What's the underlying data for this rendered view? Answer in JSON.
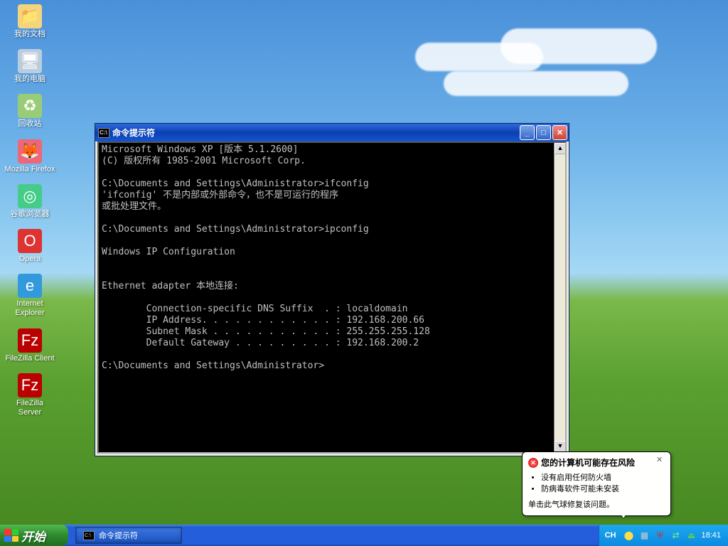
{
  "desktop": {
    "icons": [
      {
        "label": "我的文档",
        "glyph": "📁",
        "bg": "#f4d47c"
      },
      {
        "label": "我的电脑",
        "glyph": "🖥",
        "bg": "#bcd"
      },
      {
        "label": "回收站",
        "glyph": "♻",
        "bg": "#9c7"
      },
      {
        "label": "Mozilla Firefox",
        "glyph": "🦊",
        "bg": "#e67"
      },
      {
        "label": "谷歌浏览器",
        "glyph": "◎",
        "bg": "#4c8"
      },
      {
        "label": "Opera",
        "glyph": "O",
        "bg": "#d33"
      },
      {
        "label": "Internet Explorer",
        "glyph": "e",
        "bg": "#39d"
      },
      {
        "label": "FileZilla Client",
        "glyph": "Fz",
        "bg": "#b00"
      },
      {
        "label": "FileZilla Server",
        "glyph": "Fz",
        "bg": "#b00"
      }
    ]
  },
  "cmd": {
    "title": "命令提示符",
    "lines": [
      "Microsoft Windows XP [版本 5.1.2600]",
      "(C) 版权所有 1985-2001 Microsoft Corp.",
      "",
      "C:\\Documents and Settings\\Administrator>ifconfig",
      "'ifconfig' 不是内部或外部命令，也不是可运行的程序",
      "或批处理文件。",
      "",
      "C:\\Documents and Settings\\Administrator>ipconfig",
      "",
      "Windows IP Configuration",
      "",
      "",
      "Ethernet adapter 本地连接:",
      "",
      "        Connection-specific DNS Suffix  . : localdomain",
      "        IP Address. . . . . . . . . . . . : 192.168.200.66",
      "        Subnet Mask . . . . . . . . . . . : 255.255.255.128",
      "        Default Gateway . . . . . . . . . : 192.168.200.2",
      "",
      "C:\\Documents and Settings\\Administrator>"
    ]
  },
  "balloon": {
    "title": "您的计算机可能存在风险",
    "bullets": [
      "没有启用任何防火墙",
      "防病毒软件可能未安装"
    ],
    "footer": "单击此气球修复该问题。"
  },
  "taskbar": {
    "start": "开始",
    "task": "命令提示符",
    "lang": "CH",
    "clock": "18:41"
  }
}
